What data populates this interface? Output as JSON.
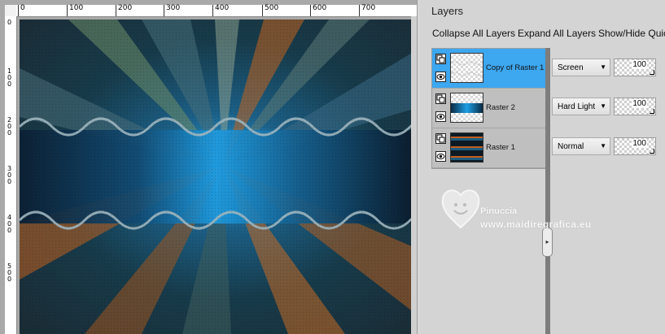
{
  "ruler": {
    "h_labels": [
      "0",
      "100",
      "200",
      "300",
      "400",
      "500",
      "600",
      "700"
    ],
    "v_labels": [
      "0",
      "1 0 0",
      "2 0 0",
      "3 0 0",
      "4 0 0",
      "5 0 0"
    ]
  },
  "layers_panel": {
    "title": "Layers",
    "toolbar": {
      "collapse_all": "Collapse All Layers",
      "expand_all": "Expand All Layers",
      "show_hide": "Show/Hide Quic"
    },
    "layers": [
      {
        "name": "Copy of Raster 1",
        "blend_mode": "Screen",
        "opacity": "100",
        "selected": true,
        "thumb": "transparent-checker"
      },
      {
        "name": "Raster 2",
        "blend_mode": "Hard Light",
        "opacity": "100",
        "selected": false,
        "thumb": "band"
      },
      {
        "name": "Raster 1",
        "blend_mode": "Normal",
        "opacity": "100",
        "selected": false,
        "thumb": "dark-stripes"
      }
    ],
    "visibility_icon": "eye-icon",
    "group_icon": "layer-group-icon",
    "dropdown_icon": "chevron-down-icon",
    "collapse_icon": "chevron-right-icon"
  },
  "watermark": {
    "name": "Pinuccia",
    "url": "www.maidiregrafica.eu",
    "icon": "heart-smiley-icon"
  },
  "colors": {
    "selection": "#3da7f0",
    "panel_bg": "#d4d4d4",
    "canvas_bg": "#a9a9a9"
  }
}
